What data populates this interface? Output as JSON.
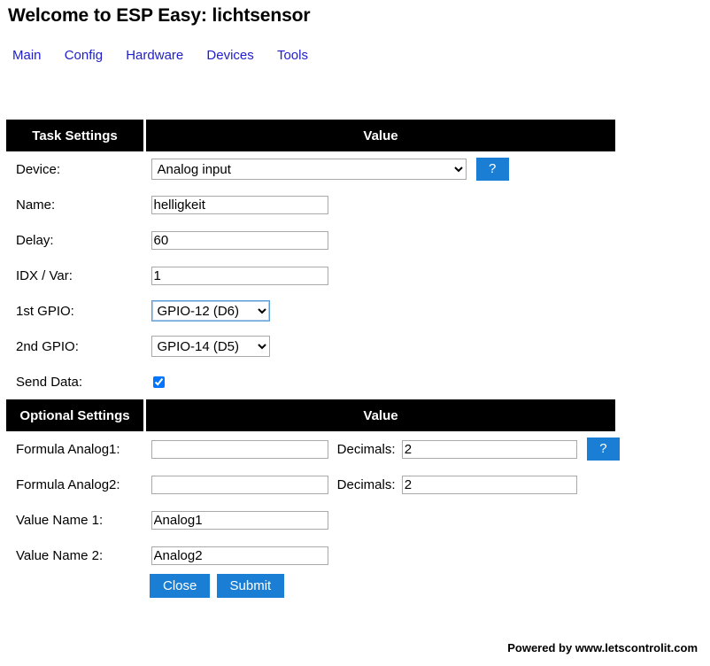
{
  "header": {
    "title": "Welcome to ESP Easy: lichtsensor"
  },
  "nav": {
    "items": [
      {
        "label": "Main"
      },
      {
        "label": "Config"
      },
      {
        "label": "Hardware"
      },
      {
        "label": "Devices"
      },
      {
        "label": "Tools"
      }
    ]
  },
  "task_settings": {
    "section_label": "Task Settings",
    "value_label": "Value",
    "device": {
      "label": "Device:",
      "value": "Analog input",
      "help_label": "?"
    },
    "name": {
      "label": "Name:",
      "value": "helligkeit"
    },
    "delay": {
      "label": "Delay:",
      "value": "60"
    },
    "idx": {
      "label": "IDX / Var:",
      "value": "1"
    },
    "gpio1": {
      "label": "1st GPIO:",
      "value": "GPIO-12 (D6)"
    },
    "gpio2": {
      "label": "2nd GPIO:",
      "value": "GPIO-14 (D5)"
    },
    "send_data": {
      "label": "Send Data:",
      "checked": true
    }
  },
  "optional_settings": {
    "section_label": "Optional Settings",
    "value_label": "Value",
    "formula1": {
      "label": "Formula Analog1:",
      "value": "",
      "decimals_label": "Decimals:",
      "decimals_value": "2",
      "help_label": "?"
    },
    "formula2": {
      "label": "Formula Analog2:",
      "value": "",
      "decimals_label": "Decimals:",
      "decimals_value": "2"
    },
    "value_name_1": {
      "label": "Value Name 1:",
      "value": "Analog1"
    },
    "value_name_2": {
      "label": "Value Name 2:",
      "value": "Analog2"
    }
  },
  "actions": {
    "close_label": "Close",
    "submit_label": "Submit"
  },
  "footer": {
    "text": "Powered by www.letscontrolit.com"
  },
  "colors": {
    "accent": "#1a7fd4",
    "link": "#2020cc",
    "header_bg": "#000000"
  }
}
